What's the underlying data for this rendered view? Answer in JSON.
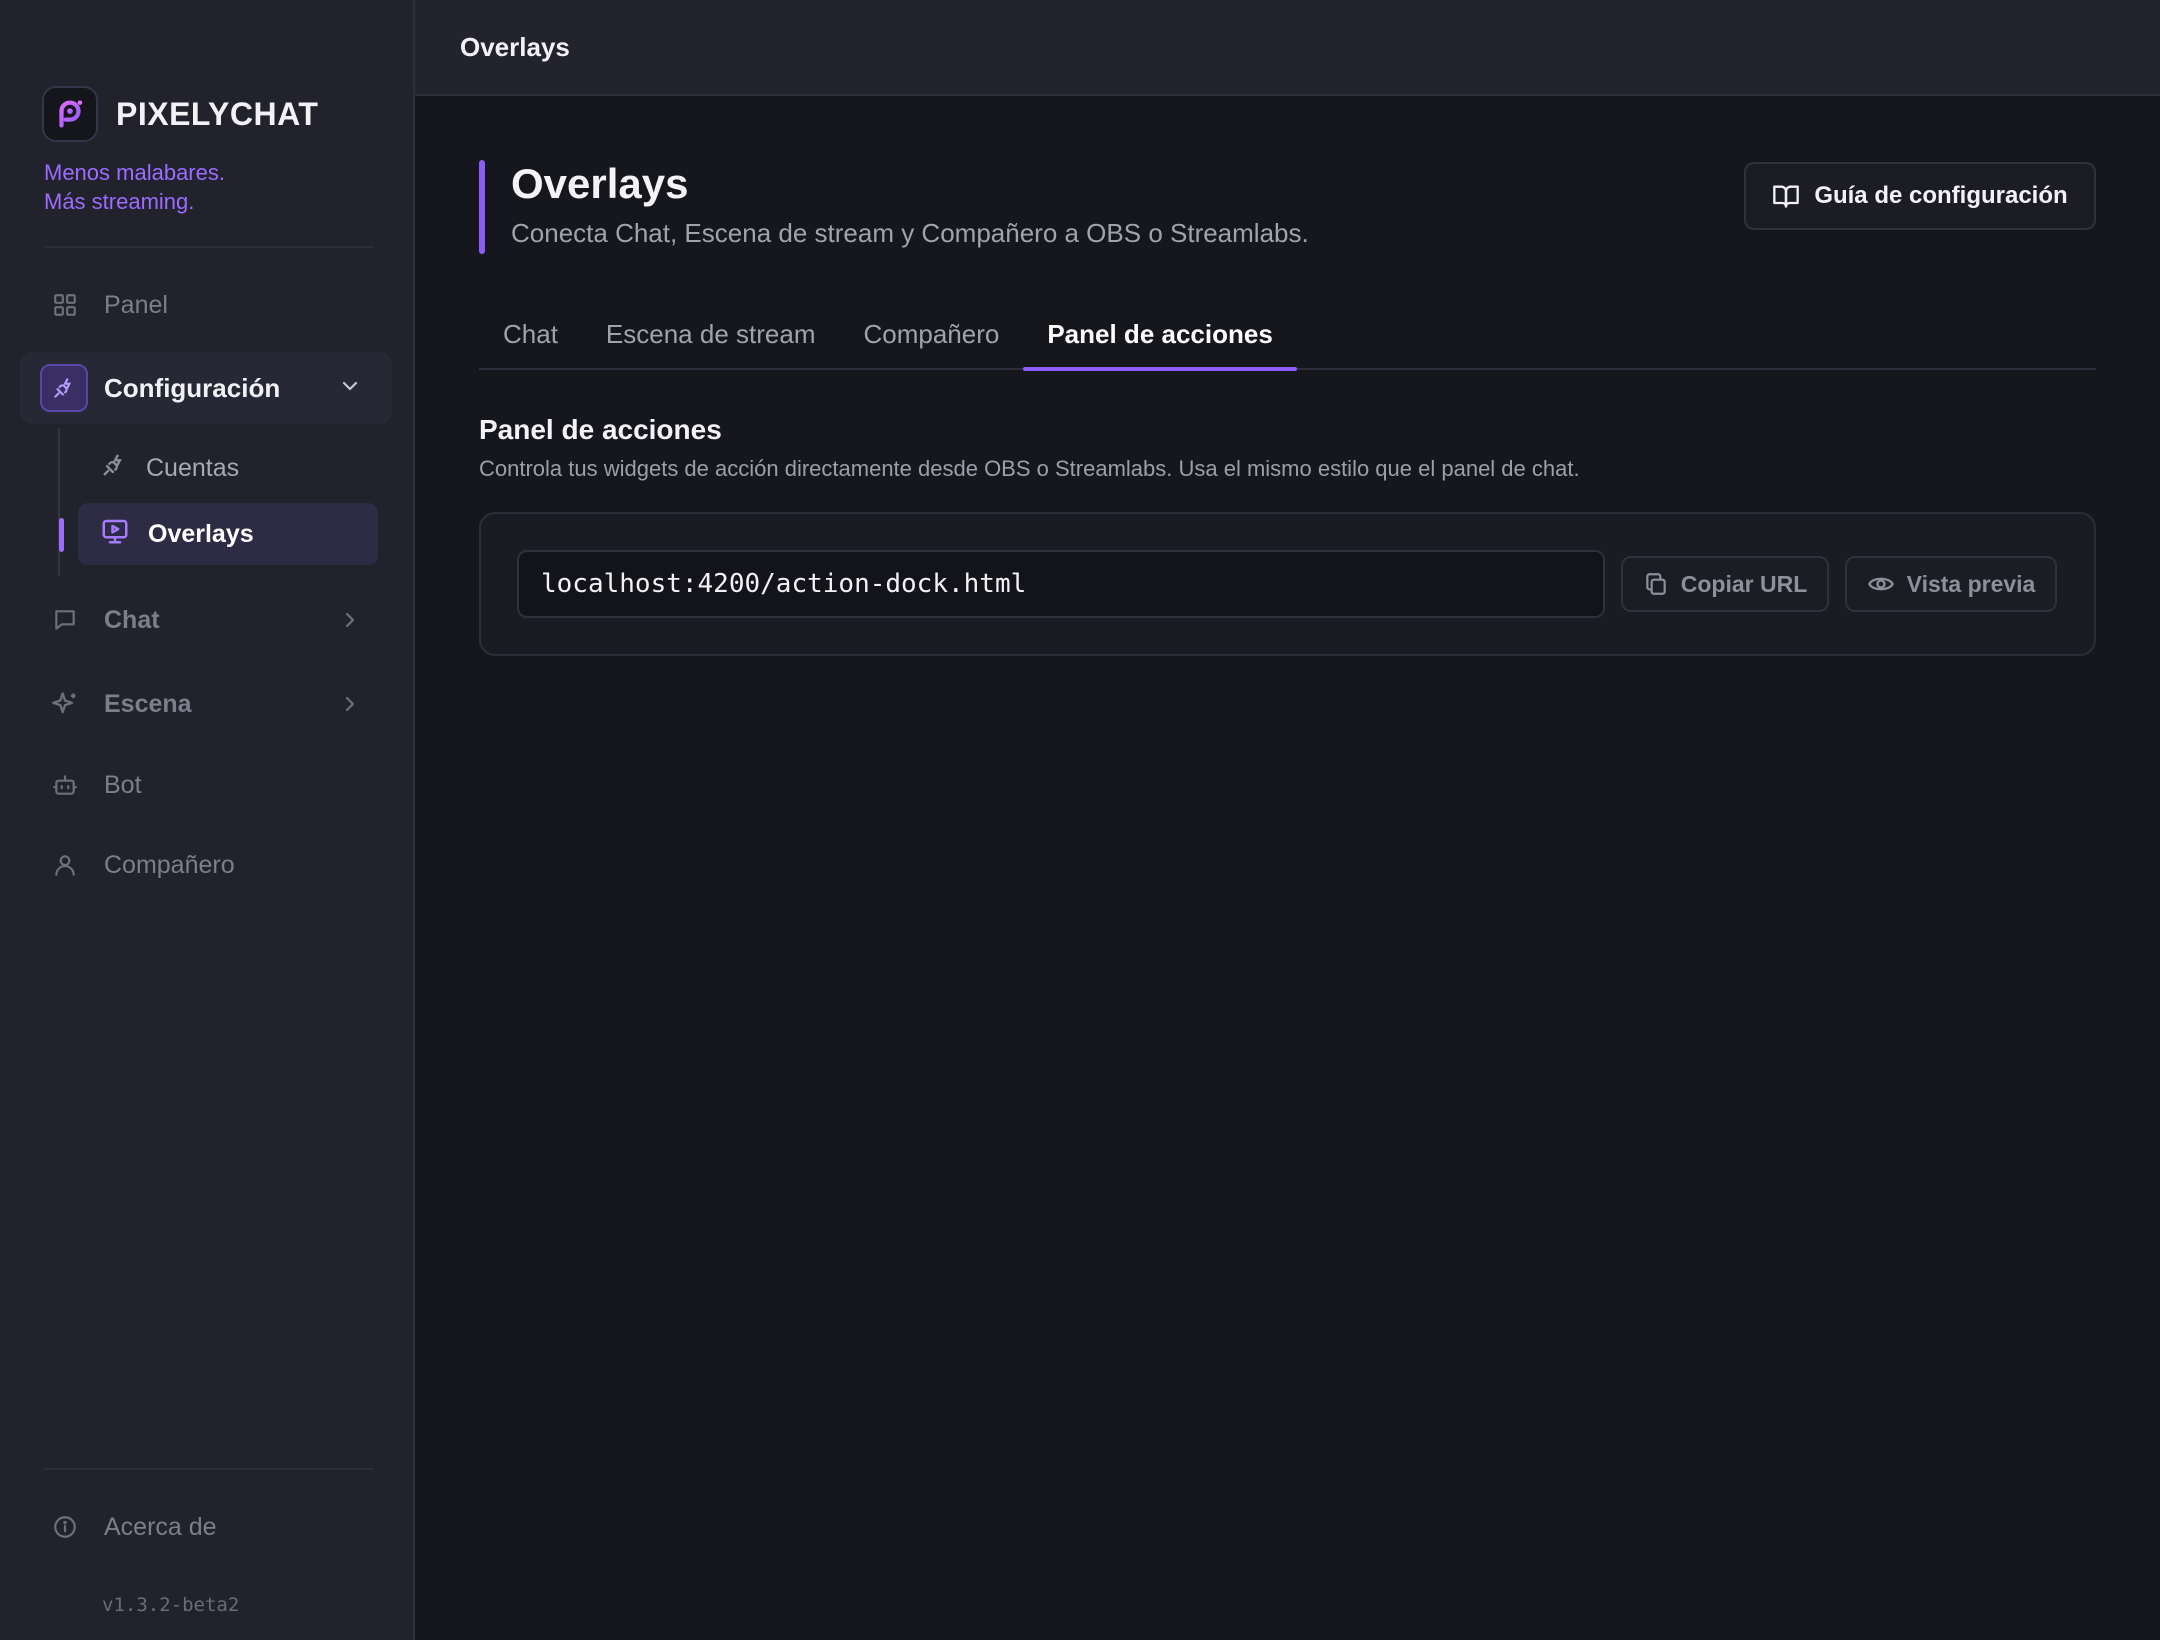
{
  "colors": {
    "accent": "#8b5cf6",
    "tagline": "#9b6cff",
    "background": "#16171c",
    "sidebar": "#21222b"
  },
  "brand": {
    "name": "PIXELYCHAT",
    "tagline_line1": "Menos malabares.",
    "tagline_line2": "Más streaming."
  },
  "sidebar": {
    "items": {
      "panel": {
        "label": "Panel",
        "icon": "grid-icon"
      },
      "configuracion": {
        "label": "Configuración",
        "icon": "plug-icon",
        "expanded": true
      },
      "cuentas": {
        "label": "Cuentas",
        "icon": "plug-icon"
      },
      "overlays": {
        "label": "Overlays",
        "icon": "monitor-play-icon",
        "active": true
      },
      "chat": {
        "label": "Chat",
        "icon": "message-square-icon"
      },
      "escena": {
        "label": "Escena",
        "icon": "sparkles-icon"
      },
      "bot": {
        "label": "Bot",
        "icon": "bot-icon"
      },
      "companero": {
        "label": "Compañero",
        "icon": "user-icon"
      },
      "acerca": {
        "label": "Acerca de",
        "icon": "info-icon"
      }
    },
    "version": "v1.3.2-beta2"
  },
  "topbar": {
    "title": "Overlays"
  },
  "page": {
    "title": "Overlays",
    "subtitle": "Conecta Chat, Escena de stream y Compañero a OBS o Streamlabs.",
    "guide_button": "Guía de configuración"
  },
  "tabs": [
    {
      "label": "Chat",
      "active": false
    },
    {
      "label": "Escena de stream",
      "active": false
    },
    {
      "label": "Compañero",
      "active": false
    },
    {
      "label": "Panel de acciones",
      "active": true
    }
  ],
  "section": {
    "title": "Panel de acciones",
    "description": "Controla tus widgets de acción directamente desde OBS o Streamlabs. Usa el mismo estilo que el panel de chat.",
    "url": "localhost:4200/action-dock.html",
    "copy_button": "Copiar URL",
    "preview_button": "Vista previa"
  }
}
